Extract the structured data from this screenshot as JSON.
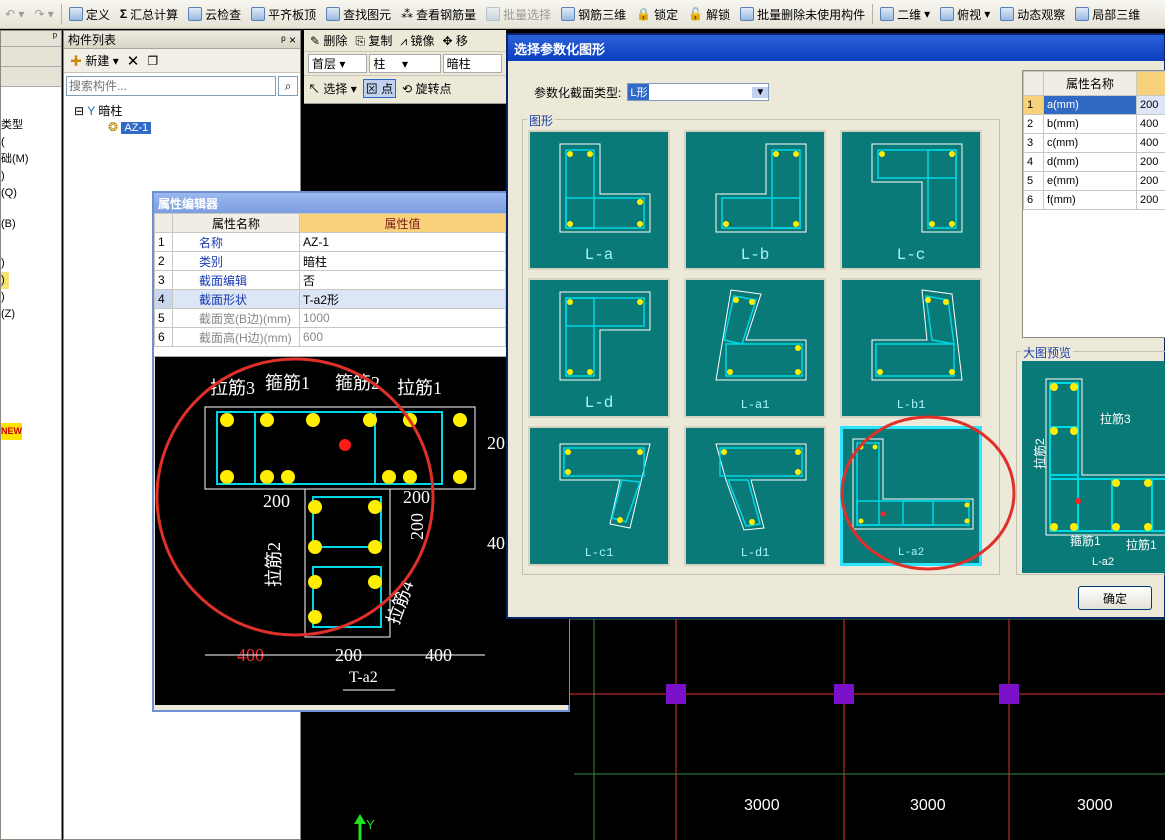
{
  "toolbar": {
    "items": [
      "定义",
      "汇总计算",
      "云检查",
      "平齐板顶",
      "查找图元",
      "查看钢筋量",
      "批量选择",
      "钢筋三维",
      "锁定",
      "解锁",
      "批量删除未使用构件",
      "二维",
      "俯视",
      "动态观察",
      "局部三维"
    ]
  },
  "left_panel": {
    "items": [
      "类型",
      "(",
      "础(M)",
      ")",
      "(Q)",
      "(B)",
      ")",
      ")",
      ")",
      "(Z)"
    ],
    "new_badge": "NEW"
  },
  "component_list": {
    "title": "构件列表",
    "pin": "ᵖ ×",
    "new_label": "新建",
    "search_placeholder": "搜索构件...",
    "tree_root": "暗柱",
    "tree_child": "AZ-1"
  },
  "edit_toolbar": {
    "delete": "删除",
    "copy": "复制",
    "mirror": "镜像",
    "move": "移",
    "floor": "首层",
    "category": "柱",
    "subtype": "暗柱",
    "select": "选择",
    "point": "点",
    "rotate_point": "旋转点"
  },
  "property_editor": {
    "title": "属性编辑器",
    "col_name": "属性名称",
    "col_value": "属性值",
    "rows": [
      {
        "n": "1",
        "name": "名称",
        "value": "AZ-1"
      },
      {
        "n": "2",
        "name": "类别",
        "value": "暗柱"
      },
      {
        "n": "3",
        "name": "截面编辑",
        "value": "否"
      },
      {
        "n": "4",
        "name": "截面形状",
        "value": "T-a2形"
      },
      {
        "n": "5",
        "name": "截面宽(B边)(mm)",
        "value": "1000"
      },
      {
        "n": "6",
        "name": "截面高(H边)(mm)",
        "value": "600"
      }
    ]
  },
  "section_drawing": {
    "labels": [
      "拉筋3",
      "箍筋1",
      "箍筋2",
      "拉筋1",
      "拉筋2",
      "拉筋4"
    ],
    "dims": [
      "200",
      "200",
      "200",
      "400",
      "200",
      "400"
    ],
    "dim_red": "400",
    "right_dims": [
      "20",
      "40"
    ],
    "name": "T-a2"
  },
  "dialog": {
    "title": "选择参数化图形",
    "type_label": "参数化截面类型:",
    "type_value": "L形",
    "shapes_group": "图形",
    "shapes": [
      "L-a",
      "L-b",
      "L-c",
      "L-d",
      "L-a1",
      "L-b1",
      "L-c1",
      "L-d1",
      "L-a2"
    ],
    "selected_shape": "L-a2",
    "param_col": "属性名称",
    "params": [
      {
        "n": "1",
        "name": "a(mm)",
        "value": "200"
      },
      {
        "n": "2",
        "name": "b(mm)",
        "value": "400"
      },
      {
        "n": "3",
        "name": "c(mm)",
        "value": "400"
      },
      {
        "n": "4",
        "name": "d(mm)",
        "value": "200"
      },
      {
        "n": "5",
        "name": "e(mm)",
        "value": "200"
      },
      {
        "n": "6",
        "name": "f(mm)",
        "value": "200"
      }
    ],
    "preview_group": "大图预览",
    "preview_labels": [
      "拉筋3",
      "拉筋2",
      "箍筋1",
      "拉筋1"
    ],
    "preview_name": "L-a2",
    "ok_label": "确定"
  },
  "canvas": {
    "dims": [
      "3000",
      "3000",
      "3000"
    ],
    "axis": "Y"
  },
  "colors": {
    "highlight_circle": "#e0302a",
    "tile_bg": "#0a7a78",
    "rebar": "#ffee00",
    "stirrup": "#00d7e6"
  }
}
